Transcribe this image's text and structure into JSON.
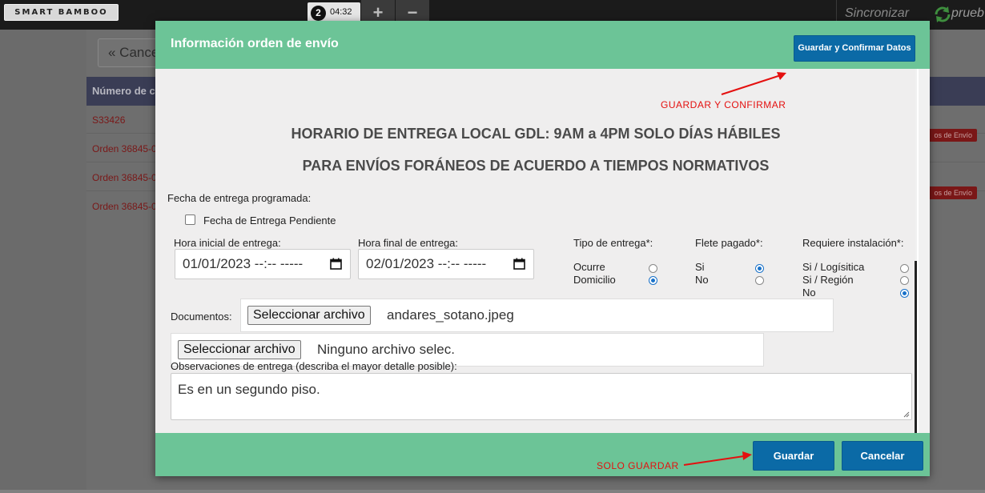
{
  "topbar": {
    "brand": "SMART BAMBOO",
    "timer_badge": "2",
    "timer": "04:32",
    "plus": "+",
    "minus": "−",
    "sync_label": "Sincronizar",
    "user": "prueb"
  },
  "background": {
    "cancel_label": "« Cance",
    "table_header": "Número de c",
    "rows": [
      "S33426",
      "Orden 36845-0",
      "Orden 36845-0",
      "Orden 36845-0"
    ],
    "row_badge": "os de Envío"
  },
  "modal": {
    "title": "Información orden de envío",
    "confirm_button": "Guardar y Confirmar Datos",
    "annotation_confirm": "GUARDAR Y CONFIRMAR",
    "banner_1": "HORARIO DE ENTREGA LOCAL GDL: 9AM a 4PM SOLO DÍAS HÁBILES",
    "banner_2": "PARA ENVÍOS FORÁNEOS DE ACUERDO A TIEMPOS NORMATIVOS",
    "scheduled_label": "Fecha de entrega programada:",
    "pending_label": "Fecha de Entrega Pendiente",
    "pending_checked": false,
    "start_label": "Hora inicial de entrega:",
    "start_value": "01/01/2023 --:-- -----",
    "end_label": "Hora final de entrega:",
    "end_value": "02/01/2023 --:-- -----",
    "delivery_type": {
      "label": "Tipo de entrega*:",
      "options": [
        "Ocurre",
        "Domicilio"
      ],
      "selected": "Domicilio"
    },
    "freight_paid": {
      "label": "Flete pagado*:",
      "options": [
        "Si",
        "No"
      ],
      "selected": "Si"
    },
    "installation": {
      "label": "Requiere instalación*:",
      "options": [
        "Si / Logísitica",
        "Si / Región",
        "No"
      ],
      "selected": "No"
    },
    "documents_label": "Documentos:",
    "file_button": "Seleccionar archivo",
    "file_1_name": "andares_sotano.jpeg",
    "file_2_name": "Ninguno archivo selec.",
    "observations_label": "Observaciones de entrega (describa el mayor detalle posible):",
    "observations_value": "Es en un segundo piso.",
    "annotation_save": "SOLO GUARDAR",
    "save_button": "Guardar",
    "cancel_button": "Cancelar"
  },
  "colors": {
    "header_green": "#6cc497",
    "button_blue": "#0b6aa6",
    "annotation_red": "#e4100f",
    "radio_blue": "#1a72c9"
  }
}
